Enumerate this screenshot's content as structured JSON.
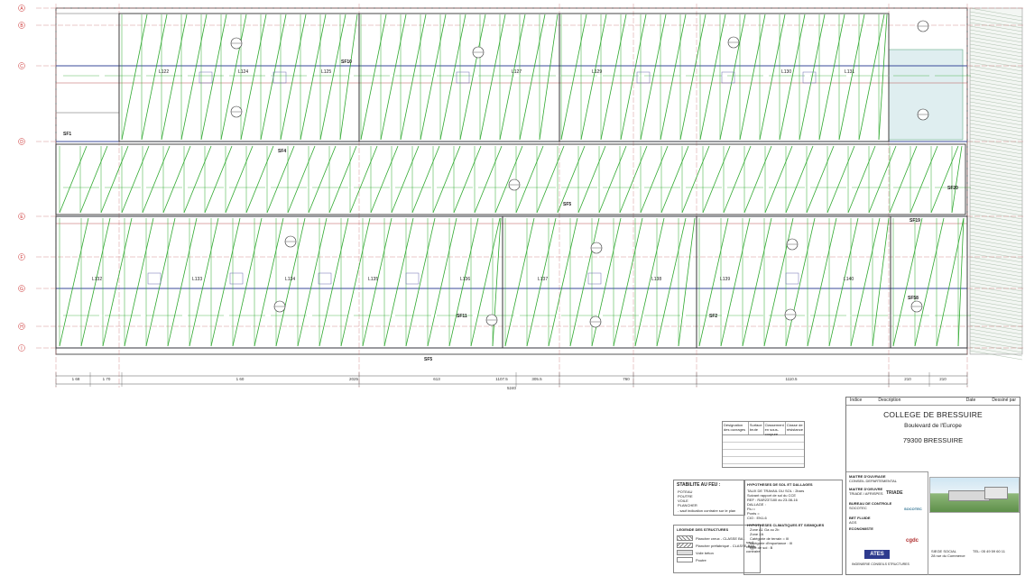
{
  "grid_rows": [
    "A",
    "B",
    "C",
    "D",
    "E",
    "F",
    "G",
    "H",
    "I"
  ],
  "beams_top": [
    "L122",
    "L124",
    "L125",
    "L127",
    "L129",
    "L130",
    "L131"
  ],
  "beams_bottom": [
    "L132",
    "L133",
    "L134",
    "L135",
    "L136",
    "L137",
    "L138",
    "L139",
    "L140"
  ],
  "slab_bottom_label": "SF5",
  "slab_labels": [
    "SF1",
    "SF4",
    "SF5",
    "SF19",
    "SF20",
    "SF58",
    "SF10",
    "SF11",
    "SF2"
  ],
  "dims_bottom": [
    "1 68",
    "1 70",
    "1 60",
    "2025",
    "613",
    "1107.5",
    "305.5",
    "760",
    "1110.5",
    "210",
    "210",
    "5240"
  ],
  "title_block": {
    "header_cols": [
      "Indice",
      "Description",
      "Date",
      "Dessiné par"
    ],
    "project": "COLLEGE DE BRESSUIRE",
    "street": "Boulevard de l'Europe",
    "city": "79300 BRESSUIRE",
    "roles": [
      {
        "title": "MAITRE D'OUVRAGE",
        "sub": "CONSEIL DEPARTEMENTAL"
      },
      {
        "title": "MAITRE D'OEUVRE",
        "sub": "TRIADE / AFRISPES"
      },
      {
        "title": "BUREAU DE CONTROLE",
        "sub": "SOCOTEC"
      },
      {
        "title": "BET FLUIDE",
        "sub": "AGS"
      },
      {
        "title": "ECONOMISTE",
        "sub": ""
      }
    ],
    "logos": [
      "TRIADE",
      "SOCOTEC",
      "ATES",
      "cgdc"
    ],
    "ates_caption": "INGENIERIE CONSEILS STRUCTURES",
    "company_lines": [
      "SIEGE SOCIAL",
      "TEL: 05 49 59 60 11",
      "28 rue du Commerce"
    ]
  },
  "stabilite": {
    "title": "STABILITE AU FEU :",
    "items": [
      "POTEAU",
      "POUTRE",
      "VOILE",
      "PLANCHER"
    ],
    "note": "- sauf indication contraire sur le plan"
  },
  "legende": {
    "title": "LEGENDE DES STRUCTURES",
    "items": [
      "Plancher creux - CLASSE BA1",
      "Plancher préfabriqué - CLASSE BA6",
      "Voile béton",
      "Poutre"
    ],
    "side": [
      "sauf relevé contraire"
    ]
  },
  "hypotheses": {
    "title": "HYPOTHESES DE SOL ET DALLAGES",
    "lines": [
      "TAUX DE TRAVAIL DU SOL : 2bars",
      "Suivant rapport de sol du CCE",
      "REF : RAR237180 du 23-08-16",
      "DALLAGE :",
      "Flu =",
      "Ponts =",
      "20kN/m²",
      "Ng =",
      "CIO : EN1-6"
    ],
    "seismic_title": "HYPOTHESES CLIMATIQUES ET SISMIQUES",
    "seismic": [
      "Zone A1 Ga ou 2b",
      "Zone 2A",
      "Catégorie de terrain = III",
      "Zone 3",
      "catégorie d'importance : III",
      "type de sol : B"
    ]
  },
  "small_table": {
    "headers": [
      "Désignation des ouvrages",
      "Surface brute",
      "Classement en sous-coupure",
      "Classe de résistance"
    ],
    "rows": [
      [
        "",
        "",
        "",
        ""
      ],
      [
        "",
        "",
        "",
        ""
      ],
      [
        "",
        "",
        "",
        ""
      ],
      [
        "",
        "",
        "",
        ""
      ],
      [
        "",
        "",
        "",
        ""
      ]
    ]
  }
}
